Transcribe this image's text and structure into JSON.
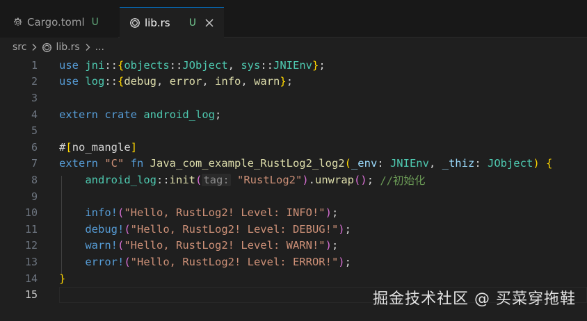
{
  "tabs": [
    {
      "icon": "gear-icon",
      "name": "Cargo.toml",
      "status": "U"
    },
    {
      "icon": "rust-icon",
      "name": "lib.rs",
      "status": "U"
    }
  ],
  "breadcrumb": {
    "folder": "src",
    "file": "lib.rs",
    "more": "..."
  },
  "lines": [
    {
      "num": "1",
      "tokens": [
        {
          "t": "use ",
          "c": "kw"
        },
        {
          "t": "jni",
          "c": "ns"
        },
        {
          "t": "::",
          "c": "punc"
        },
        {
          "t": "{",
          "c": "brace1"
        },
        {
          "t": "objects",
          "c": "ns"
        },
        {
          "t": "::",
          "c": "punc"
        },
        {
          "t": "JObject",
          "c": "ty"
        },
        {
          "t": ", ",
          "c": "punc"
        },
        {
          "t": "sys",
          "c": "ns"
        },
        {
          "t": "::",
          "c": "punc"
        },
        {
          "t": "JNIEnv",
          "c": "ty"
        },
        {
          "t": "}",
          "c": "brace1"
        },
        {
          "t": ";",
          "c": "punc"
        }
      ]
    },
    {
      "num": "2",
      "tokens": [
        {
          "t": "use ",
          "c": "kw"
        },
        {
          "t": "log",
          "c": "ns"
        },
        {
          "t": "::",
          "c": "punc"
        },
        {
          "t": "{",
          "c": "brace1"
        },
        {
          "t": "debug",
          "c": "fn"
        },
        {
          "t": ", ",
          "c": "punc"
        },
        {
          "t": "error",
          "c": "fn"
        },
        {
          "t": ", ",
          "c": "punc"
        },
        {
          "t": "info",
          "c": "fn"
        },
        {
          "t": ", ",
          "c": "punc"
        },
        {
          "t": "warn",
          "c": "fn"
        },
        {
          "t": "}",
          "c": "brace1"
        },
        {
          "t": ";",
          "c": "punc"
        }
      ]
    },
    {
      "num": "3",
      "tokens": []
    },
    {
      "num": "4",
      "tokens": [
        {
          "t": "extern ",
          "c": "kw"
        },
        {
          "t": "crate ",
          "c": "kw"
        },
        {
          "t": "android_log",
          "c": "ns"
        },
        {
          "t": ";",
          "c": "punc"
        }
      ]
    },
    {
      "num": "5",
      "tokens": []
    },
    {
      "num": "6",
      "tokens": [
        {
          "t": "#",
          "c": "attr"
        },
        {
          "t": "[",
          "c": "brace1"
        },
        {
          "t": "no_mangle",
          "c": "attr"
        },
        {
          "t": "]",
          "c": "brace1"
        }
      ]
    },
    {
      "num": "7",
      "tokens": [
        {
          "t": "extern ",
          "c": "kw"
        },
        {
          "t": "\"C\" ",
          "c": "str"
        },
        {
          "t": "fn ",
          "c": "kw"
        },
        {
          "t": "Java_com_example_RustLog2_log2",
          "c": "fn"
        },
        {
          "t": "(",
          "c": "brace1"
        },
        {
          "t": "_env",
          "c": "var"
        },
        {
          "t": ": ",
          "c": "punc"
        },
        {
          "t": "JNIEnv",
          "c": "ty"
        },
        {
          "t": ", ",
          "c": "punc"
        },
        {
          "t": "_thiz",
          "c": "var"
        },
        {
          "t": ": ",
          "c": "punc"
        },
        {
          "t": "JObject",
          "c": "ty"
        },
        {
          "t": ") ",
          "c": "brace1"
        },
        {
          "t": "{",
          "c": "brace1"
        }
      ]
    },
    {
      "num": "8",
      "tokens": [
        {
          "t": "    ",
          "c": "punc"
        },
        {
          "t": "android_log",
          "c": "ns"
        },
        {
          "t": "::",
          "c": "punc"
        },
        {
          "t": "init",
          "c": "fn"
        },
        {
          "t": "(",
          "c": "brace2"
        },
        {
          "t": "tag:",
          "c": "hint"
        },
        {
          "t": " ",
          "c": "punc"
        },
        {
          "t": "\"RustLog2\"",
          "c": "str"
        },
        {
          "t": ")",
          "c": "brace2"
        },
        {
          "t": ".",
          "c": "punc"
        },
        {
          "t": "unwrap",
          "c": "fn"
        },
        {
          "t": "()",
          "c": "brace2"
        },
        {
          "t": "; ",
          "c": "punc"
        },
        {
          "t": "//初始化",
          "c": "cm"
        }
      ]
    },
    {
      "num": "9",
      "tokens": []
    },
    {
      "num": "10",
      "tokens": [
        {
          "t": "    ",
          "c": "punc"
        },
        {
          "t": "info!",
          "c": "mac"
        },
        {
          "t": "(",
          "c": "brace2"
        },
        {
          "t": "\"Hello, RustLog2! Level: INFO!\"",
          "c": "str"
        },
        {
          "t": ")",
          "c": "brace2"
        },
        {
          "t": ";",
          "c": "punc"
        }
      ]
    },
    {
      "num": "11",
      "tokens": [
        {
          "t": "    ",
          "c": "punc"
        },
        {
          "t": "debug!",
          "c": "mac"
        },
        {
          "t": "(",
          "c": "brace2"
        },
        {
          "t": "\"Hello, RustLog2! Level: DEBUG!\"",
          "c": "str"
        },
        {
          "t": ")",
          "c": "brace2"
        },
        {
          "t": ";",
          "c": "punc"
        }
      ]
    },
    {
      "num": "12",
      "tokens": [
        {
          "t": "    ",
          "c": "punc"
        },
        {
          "t": "warn!",
          "c": "mac"
        },
        {
          "t": "(",
          "c": "brace2"
        },
        {
          "t": "\"Hello, RustLog2! Level: WARN!\"",
          "c": "str"
        },
        {
          "t": ")",
          "c": "brace2"
        },
        {
          "t": ";",
          "c": "punc"
        }
      ]
    },
    {
      "num": "13",
      "tokens": [
        {
          "t": "    ",
          "c": "punc"
        },
        {
          "t": "error!",
          "c": "mac"
        },
        {
          "t": "(",
          "c": "brace2"
        },
        {
          "t": "\"Hello, RustLog2! Level: ERROR!\"",
          "c": "str"
        },
        {
          "t": ")",
          "c": "brace2"
        },
        {
          "t": ";",
          "c": "punc"
        }
      ]
    },
    {
      "num": "14",
      "tokens": [
        {
          "t": "}",
          "c": "brace1"
        }
      ]
    },
    {
      "num": "15",
      "tokens": []
    }
  ],
  "current_line": "15",
  "watermark": "掘金技术社区 @ 买菜穿拖鞋"
}
